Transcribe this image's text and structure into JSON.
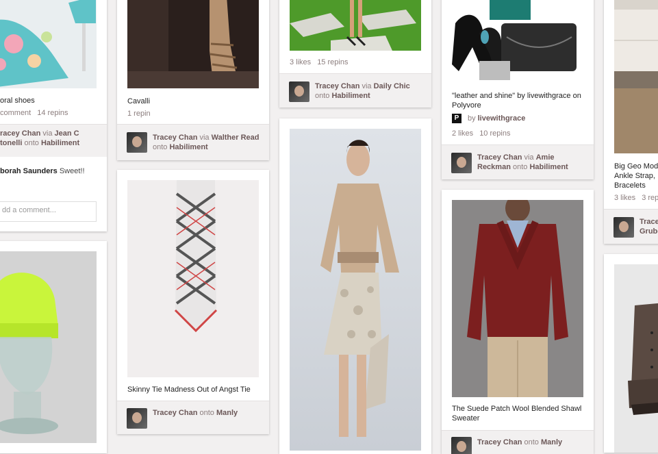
{
  "colors": {
    "background": "#f2f0f0",
    "user_name": "#6b5757",
    "muted_text": "#8c7e7e"
  },
  "pins": [
    {
      "description": "oral shoes",
      "stats": [
        "comment",
        "14 repins"
      ],
      "attribution": {
        "user": "racey Chan",
        "via_word": "via",
        "via": "Jean C",
        "line2_via": "tonelli",
        "onto_word": "onto",
        "board": "Habiliment"
      },
      "comment": {
        "user": "borah Saunders",
        "text": "Sweet!!"
      },
      "comment_placeholder": "dd a comment..."
    },
    {
      "description": "Cavalli",
      "stats": [
        "1 repin"
      ],
      "attribution": {
        "user": "Tracey Chan",
        "via_word": "via",
        "via": "Walther Read",
        "onto_word": "onto",
        "board": "Habiliment"
      }
    },
    {
      "stats": [
        "3 likes",
        "15 repins"
      ],
      "attribution": {
        "user": "Tracey Chan",
        "via_word": "via",
        "via": "Daily Chic",
        "onto_word": "onto",
        "board": "Habiliment"
      }
    },
    {
      "description": "\"leather and shine\" by livewithgrace on Polyvore",
      "source": {
        "by_word": "by",
        "name": "livewithgrace",
        "icon": "pinterest-p-icon"
      },
      "stats": [
        "2 likes",
        "10 repins"
      ],
      "attribution": {
        "user": "Tracey Chan",
        "via_word": "via",
        "via": "Amie",
        "line2_via": "Reckman",
        "onto_word": "onto",
        "board": "Habiliment"
      }
    },
    {
      "description": "Big Geo Mod Ankle Strap, Bracelets",
      "stats": [
        "3 likes",
        "3 rep"
      ],
      "attribution": {
        "user": "Trace",
        "line2_via": "Grube"
      }
    },
    {
      "description": "Skinny Tie Madness Out of Angst Tie",
      "attribution": {
        "user": "Tracey Chan",
        "onto_word": "onto",
        "board": "Manly"
      }
    },
    {
      "description": "The Suede Patch Wool Blended Shawl Sweater",
      "attribution": {
        "user": "Tracey Chan",
        "onto_word": "onto",
        "board": "Manly"
      }
    }
  ],
  "images": [
    {
      "name": "floral-heels-image",
      "subject": "floral shoes"
    },
    {
      "name": "strappy-heels-image",
      "subject": "cavalli shoes"
    },
    {
      "name": "grass-sandals-image",
      "subject": "sandals on grass"
    },
    {
      "name": "polyvore-set-image",
      "subject": "leather and shine set"
    },
    {
      "name": "interior-image",
      "subject": "interior"
    },
    {
      "name": "neon-beanie-image",
      "subject": "neon beanie on glass head"
    },
    {
      "name": "plaid-tie-image",
      "subject": "skinny plaid tie"
    },
    {
      "name": "runway-model-image",
      "subject": "runway look"
    },
    {
      "name": "shawl-sweater-image",
      "subject": "suede patch shawl sweater"
    },
    {
      "name": "boot-image",
      "subject": "leather boot"
    }
  ]
}
